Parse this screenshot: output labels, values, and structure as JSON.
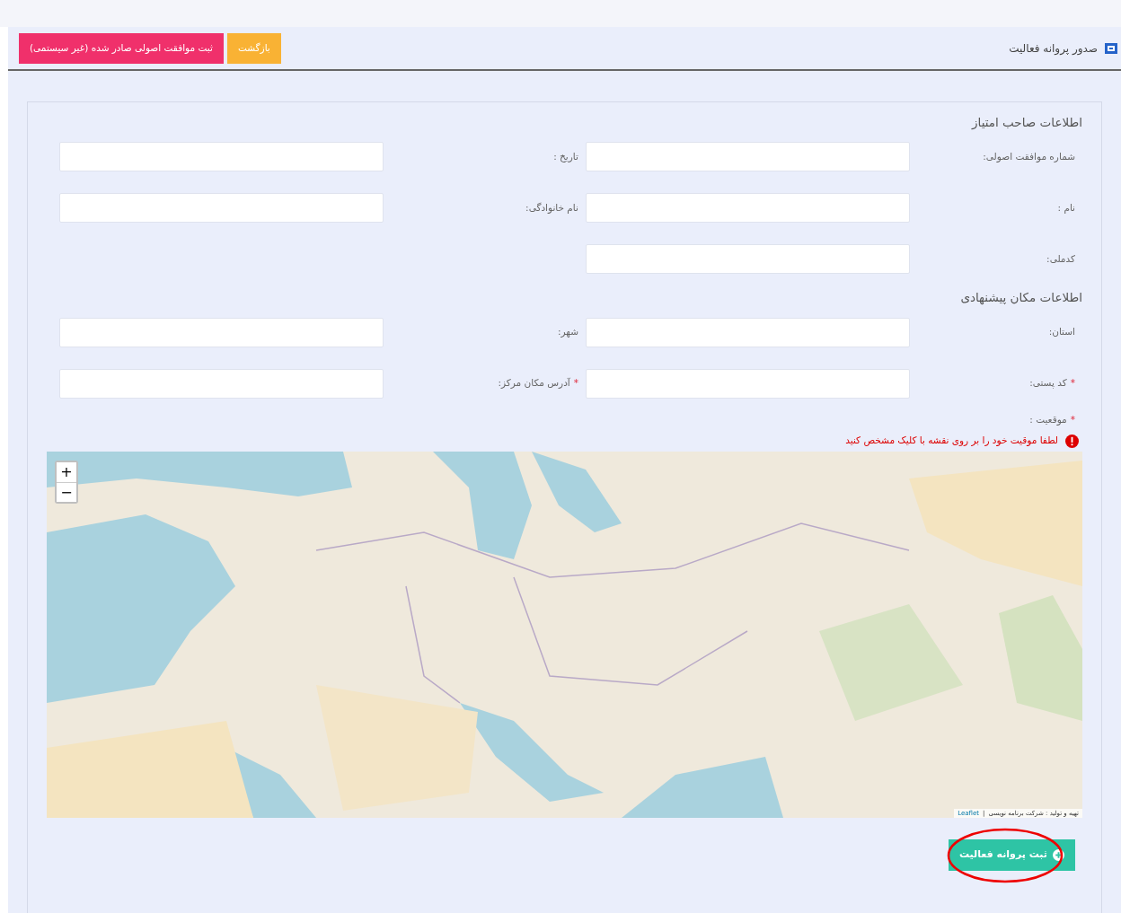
{
  "header": {
    "title": "صدور پروانه فعالیت",
    "buttons": [
      {
        "label": "بازگشت",
        "kind": "warning"
      },
      {
        "label": "ثبت موافقت اصولی صادر شده (غیر سیستمی)",
        "kind": "danger"
      }
    ]
  },
  "sections": [
    {
      "title": "اطلاعات صاحب امتیاز",
      "fields": [
        {
          "label": "شماره موافقت اصولی:"
        },
        {
          "label": "تاریخ :"
        },
        {
          "label": "نام :"
        },
        {
          "label": "نام خانوادگی:"
        },
        {
          "label": "کدملی:"
        }
      ]
    },
    {
      "title": "اطلاعات مکان پیشنهادی",
      "fields": [
        {
          "label": "استان:"
        },
        {
          "label": "شهر:"
        },
        {
          "label": "کد پستی:",
          "required_mark": "*"
        },
        {
          "label": "آدرس مکان مرکز:",
          "required_mark": "*"
        }
      ]
    }
  ],
  "location": {
    "label": "موقعیت :",
    "required_mark": "*",
    "error": "لطفا موقیت خود را بر روی نقشه با کلیک مشخص کنید"
  },
  "map": {
    "kind": "picture",
    "zoom_in": "+",
    "zoom_out": "−",
    "attribution_link": "Leaflet",
    "attribution_separator": "|",
    "attribution": "تهیه و تولید : شرکت برنامه نویسی"
  },
  "submit": {
    "label": "ثبت پروانه فعالیت",
    "highlighted": true
  }
}
